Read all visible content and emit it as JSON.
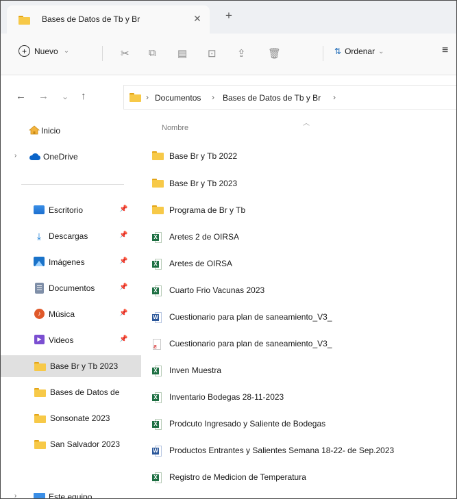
{
  "tab": {
    "title": "Bases de Datos de Tb y Br",
    "close_glyph": "✕",
    "new_tab_glyph": "+"
  },
  "toolbar": {
    "new_label": "Nuevo",
    "sort_label": "Ordenar",
    "icons": [
      "cut-icon",
      "copy-icon",
      "paste-icon",
      "rename-icon",
      "share-icon",
      "delete-icon",
      "view-icon"
    ]
  },
  "address": {
    "crumbs": [
      "Documentos",
      "Bases de Datos de Tb y Br"
    ],
    "separator": "›"
  },
  "sidebar": {
    "items": [
      {
        "label": "Inicio",
        "icon": "home-icon",
        "pinned": false
      },
      {
        "label": "OneDrive",
        "icon": "onedrive-icon",
        "pinned": false
      },
      {
        "label": "Escritorio",
        "icon": "desktop-icon",
        "pinned": true
      },
      {
        "label": "Descargas",
        "icon": "download-icon",
        "pinned": true
      },
      {
        "label": "Imágenes",
        "icon": "pictures-icon",
        "pinned": true
      },
      {
        "label": "Documentos",
        "icon": "documents-icon",
        "pinned": true
      },
      {
        "label": "Música",
        "icon": "music-icon",
        "pinned": true
      },
      {
        "label": "Videos",
        "icon": "videos-icon",
        "pinned": true
      },
      {
        "label": "Base Br y Tb 2023",
        "icon": "folder-icon",
        "pinned": false,
        "selected": true
      },
      {
        "label": "Bases de Datos de",
        "icon": "folder-icon",
        "pinned": false
      },
      {
        "label": "Sonsonate 2023",
        "icon": "folder-icon",
        "pinned": false
      },
      {
        "label": "San Salvador 2023",
        "icon": "folder-icon",
        "pinned": false
      },
      {
        "label": "Este equipo",
        "icon": "pc-icon",
        "pinned": false
      }
    ]
  },
  "content": {
    "column_header": "Nombre",
    "files": [
      {
        "name": "Base Br y Tb 2022",
        "type": "folder"
      },
      {
        "name": "Base Br y Tb 2023",
        "type": "folder"
      },
      {
        "name": "Programa de Br y Tb",
        "type": "folder"
      },
      {
        "name": "Aretes 2 de OIRSA",
        "type": "excel"
      },
      {
        "name": "Aretes de OIRSA",
        "type": "excel"
      },
      {
        "name": "Cuarto Frio Vacunas 2023",
        "type": "excel"
      },
      {
        "name": "Cuestionario para plan de saneamiento_V3_",
        "type": "word"
      },
      {
        "name": "Cuestionario para plan de saneamiento_V3_",
        "type": "pdf"
      },
      {
        "name": "Inven Muestra",
        "type": "excel"
      },
      {
        "name": "Inventario Bodegas 28-11-2023",
        "type": "excel"
      },
      {
        "name": "Prodcuto Ingresado y Saliente de Bodegas",
        "type": "excel"
      },
      {
        "name": "Productos Entrantes y Salientes Semana 18-22- de Sep.2023",
        "type": "word"
      },
      {
        "name": "Registro de Medicion de Temperatura",
        "type": "excel"
      }
    ]
  },
  "colors": {
    "folder": "#f7c948",
    "excel": "#1d6f42",
    "word": "#2b579a",
    "pdf": "#d83b3b",
    "selected": "#e0e0e0"
  }
}
